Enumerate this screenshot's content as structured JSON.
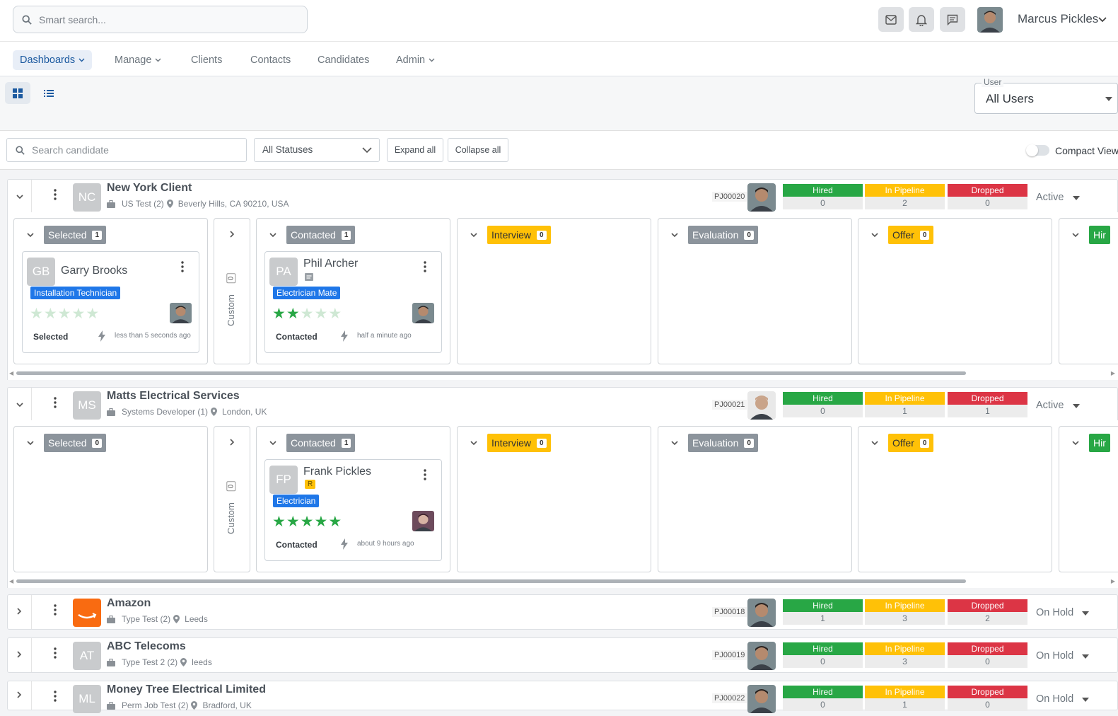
{
  "search": {
    "placeholder": "Smart search..."
  },
  "user": {
    "name": "Marcus Pickles"
  },
  "nav": {
    "items": [
      {
        "label": "Dashboards"
      },
      {
        "label": "Manage"
      },
      {
        "label": "Clients"
      },
      {
        "label": "Contacts"
      },
      {
        "label": "Candidates"
      },
      {
        "label": "Admin"
      }
    ]
  },
  "user_filter": {
    "label": "User",
    "value": "All Users"
  },
  "filters": {
    "search_placeholder": "Search candidate",
    "status": "All Statuses",
    "expand": "Expand all",
    "collapse": "Collapse all",
    "compact": "Compact View"
  },
  "stat_labels": {
    "hired": "Hired",
    "pipeline": "In Pipeline",
    "dropped": "Dropped"
  },
  "colors": {
    "hired": "#28a745",
    "pipeline": "#ffc107",
    "dropped": "#dc3545",
    "selected": "#8c949c",
    "accent": "#1c5aa0"
  },
  "custom": {
    "label": "Custom",
    "count": "0"
  },
  "clients": [
    {
      "initials": "NC",
      "name": "New York Client",
      "job": "US Test (2)",
      "location": "Beverly Hills, CA 90210, USA",
      "pj": "PJ00020",
      "hired": "0",
      "pipeline": "2",
      "dropped": "0",
      "status": "Active"
    },
    {
      "initials": "MS",
      "name": "Matts Electrical Services",
      "job": "Systems Developer (1)",
      "location": "London, UK",
      "pj": "PJ00021",
      "hired": "0",
      "pipeline": "1",
      "dropped": "1",
      "status": "Active"
    },
    {
      "initials": "",
      "name": "Amazon",
      "job": "Type Test (2)",
      "location": "Leeds",
      "pj": "PJ00018",
      "hired": "1",
      "pipeline": "3",
      "dropped": "2",
      "status": "On Hold"
    },
    {
      "initials": "AT",
      "name": "ABC Telecoms",
      "job": "Type Test 2 (2)",
      "location": "leeds",
      "pj": "PJ00019",
      "hired": "0",
      "pipeline": "3",
      "dropped": "0",
      "status": "On Hold"
    },
    {
      "initials": "ML",
      "name": "Money Tree Electrical Limited",
      "job": "Perm Job Test (2)",
      "location": "Bradford, UK",
      "pj": "PJ00022",
      "hired": "0",
      "pipeline": "1",
      "dropped": "0",
      "status": "On Hold"
    }
  ],
  "boards": [
    {
      "stages": [
        {
          "label": "Selected",
          "count": "1"
        },
        {
          "label": "Contacted",
          "count": "1"
        },
        {
          "label": "Interview",
          "count": "0"
        },
        {
          "label": "Evaluation",
          "count": "0"
        },
        {
          "label": "Offer",
          "count": "0"
        },
        {
          "label": "Hir",
          "count": ""
        }
      ],
      "cards": [
        {
          "initials": "GB",
          "name": "Garry Brooks",
          "role": "Installation Technician",
          "rating": 0,
          "status": "Selected",
          "ago": "less than 5 seconds ago"
        },
        {
          "initials": "PA",
          "name": "Phil Archer",
          "role": "Electrician Mate",
          "rating": 2,
          "status": "Contacted",
          "ago": "half a minute ago"
        }
      ]
    },
    {
      "stages": [
        {
          "label": "Selected",
          "count": "0"
        },
        {
          "label": "Contacted",
          "count": "1"
        },
        {
          "label": "Interview",
          "count": "0"
        },
        {
          "label": "Evaluation",
          "count": "0"
        },
        {
          "label": "Offer",
          "count": "0"
        },
        {
          "label": "Hir",
          "count": ""
        }
      ],
      "cards": [
        {
          "initials": "FP",
          "name": "Frank Pickles",
          "badge": "R",
          "role": "Electrician",
          "rating": 5,
          "status": "Contacted",
          "ago": "about 9 hours ago"
        }
      ]
    }
  ]
}
